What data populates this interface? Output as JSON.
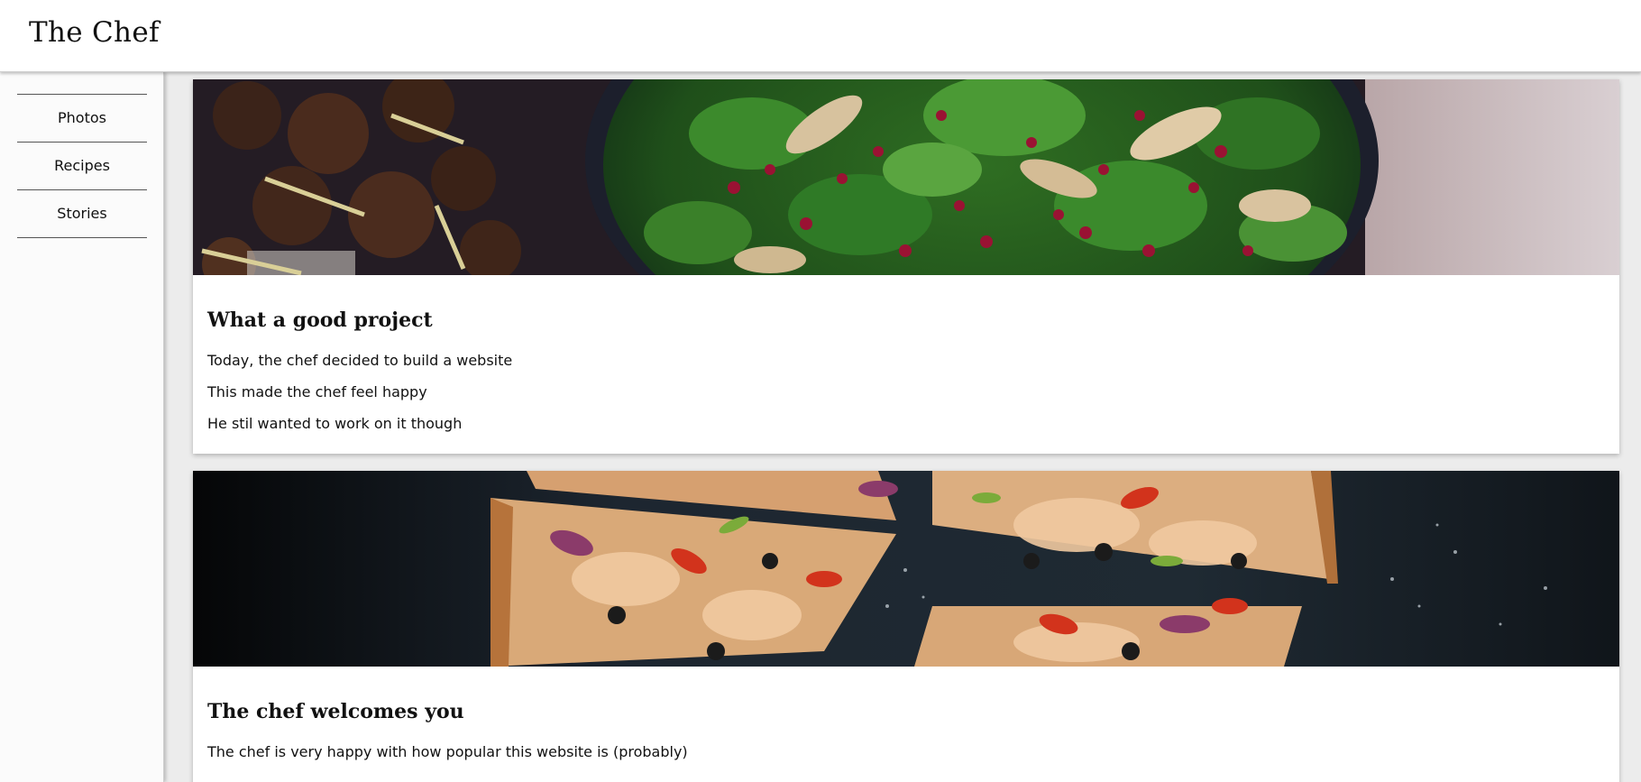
{
  "header": {
    "title": "The Chef"
  },
  "sidebar": {
    "items": [
      {
        "label": "Photos"
      },
      {
        "label": "Recipes"
      },
      {
        "label": "Stories"
      }
    ]
  },
  "posts": [
    {
      "image_icon": "salad-photo",
      "title": "What a good project",
      "paragraphs": [
        "Today, the chef decided to build a website",
        "This made the chef feel happy",
        "He stil wanted to work on it though"
      ]
    },
    {
      "image_icon": "pizza-photo",
      "title": "The chef welcomes you",
      "paragraphs": [
        "The chef is very happy with how popular this website is (probably)"
      ]
    }
  ],
  "colors": {
    "background": "#ececec",
    "card": "#ffffff",
    "sidebar": "#fbfbfb",
    "text": "#111111"
  }
}
